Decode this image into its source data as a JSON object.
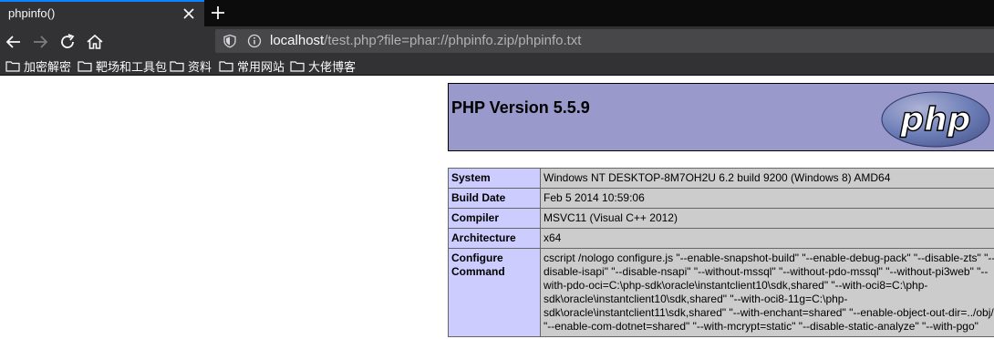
{
  "browser": {
    "tab_title": "phpinfo()",
    "url_host": "localhost",
    "url_rest": "/test.php?file=phar://phpinfo.zip/phpinfo.txt",
    "accent_color": "#0a84ff",
    "bookmarks": [
      {
        "label": "加密解密",
        "icon": "folder-icon"
      },
      {
        "label": "靶场和工具包",
        "icon": "folder-icon"
      },
      {
        "label": "资料",
        "icon": "folder-icon"
      },
      {
        "label": "常用网站",
        "icon": "folder-icon"
      },
      {
        "label": "大佬博客",
        "icon": "folder-icon"
      }
    ]
  },
  "page": {
    "version_title": "PHP Version 5.5.9",
    "logo_text": "php",
    "header_color": "#9999cc",
    "rows": [
      {
        "key": "System",
        "value": "Windows NT DESKTOP-8M7OH2U 6.2 build 9200 (Windows 8) AMD64"
      },
      {
        "key": "Build Date",
        "value": "Feb 5 2014 10:59:06"
      },
      {
        "key": "Compiler",
        "value": "MSVC11 (Visual C++ 2012)"
      },
      {
        "key": "Architecture",
        "value": "x64"
      },
      {
        "key": "Configure Command",
        "value": "cscript /nologo configure.js \"--enable-snapshot-build\" \"--enable-debug-pack\" \"--disable-zts\" \"--disable-isapi\" \"--disable-nsapi\" \"--without-mssql\" \"--without-pdo-mssql\" \"--without-pi3web\" \"--with-pdo-oci=C:\\php-sdk\\oracle\\instantclient10\\sdk,shared\" \"--with-oci8=C:\\php-sdk\\oracle\\instantclient10\\sdk,shared\" \"--with-oci8-11g=C:\\php-sdk\\oracle\\instantclient11\\sdk,shared\" \"--with-enchant=shared\" \"--enable-object-out-dir=../obj/\" \"--enable-com-dotnet=shared\" \"--with-mcrypt=static\" \"--disable-static-analyze\" \"--with-pgo\""
      }
    ]
  }
}
